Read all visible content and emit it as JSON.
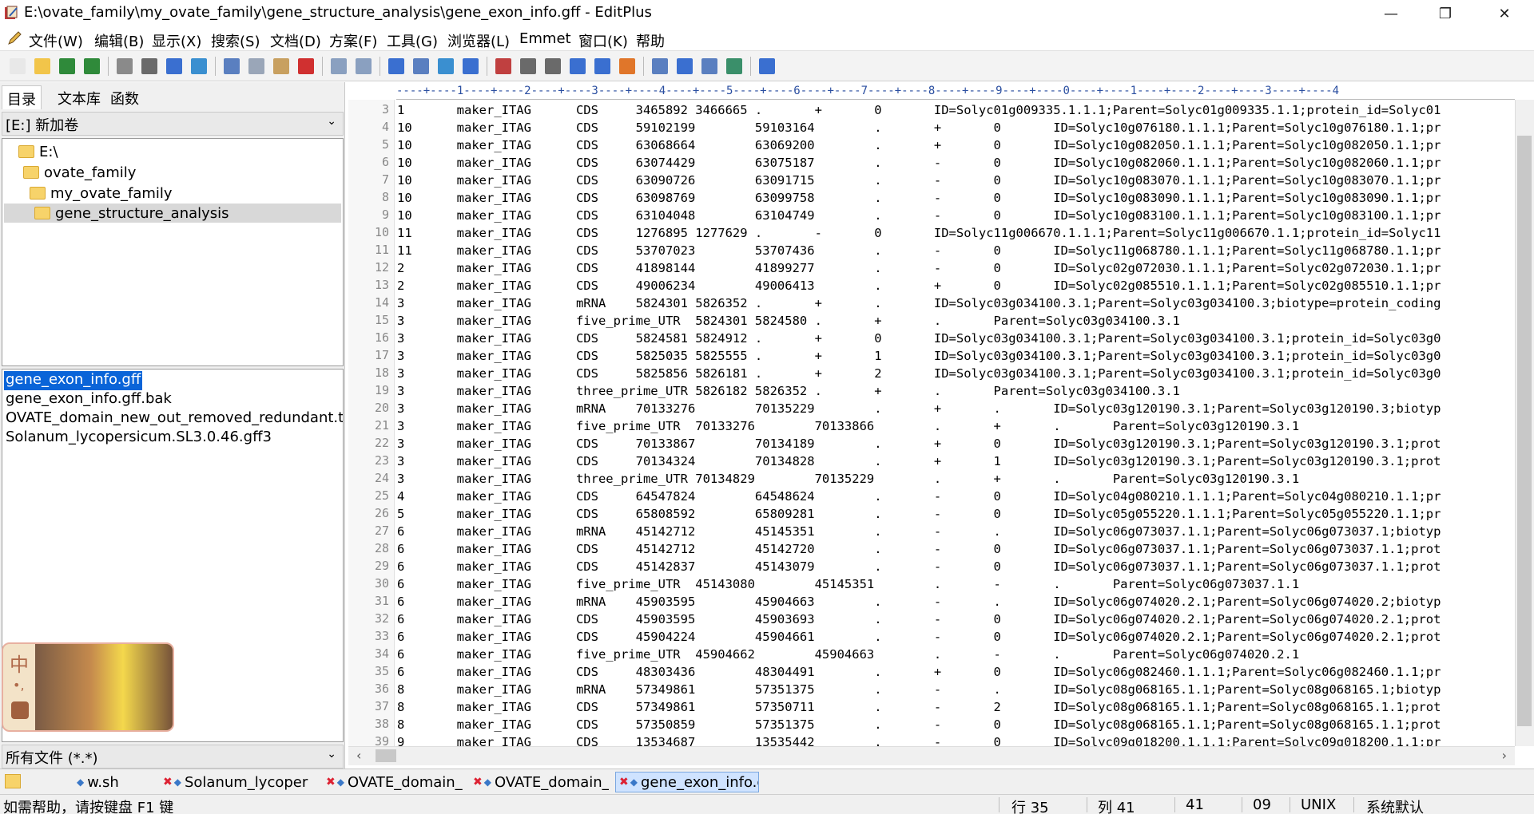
{
  "window": {
    "title": "E:\\ovate_family\\my_ovate_family\\gene_structure_analysis\\gene_exon_info.gff - EditPlus",
    "minimize": "—",
    "restore": "❐",
    "close": "✕"
  },
  "menu": [
    "文件(W)",
    "编辑(B)",
    "显示(X)",
    "搜索(S)",
    "文档(D)",
    "方案(F)",
    "工具(G)",
    "浏览器(L)",
    "Emmet",
    "窗口(K)",
    "帮助"
  ],
  "mdi": {
    "minimize": "–",
    "restore": "▫",
    "close": "×"
  },
  "toolbar_icons": [
    {
      "name": "new-file-icon",
      "color": "#e8e8e8"
    },
    {
      "name": "open-folder-icon",
      "color": "#f2c54a"
    },
    {
      "name": "save-icon",
      "color": "#2f8a3a"
    },
    {
      "name": "save-all-icon",
      "color": "#2f8a3a"
    },
    {
      "name": "print-preview-icon",
      "color": "#8a8a8a"
    },
    {
      "name": "print-icon",
      "color": "#6a6a6a"
    },
    {
      "name": "spell-check-icon",
      "color": "#3a6fd0"
    },
    {
      "name": "browser-view-icon",
      "color": "#3a8fd0"
    },
    {
      "name": "cut-icon",
      "color": "#5a7fc0"
    },
    {
      "name": "copy-icon",
      "color": "#9aa6b8"
    },
    {
      "name": "paste-icon",
      "color": "#c8a060"
    },
    {
      "name": "delete-icon",
      "color": "#d03030"
    },
    {
      "name": "undo-icon",
      "color": "#8aa0c0"
    },
    {
      "name": "redo-icon",
      "color": "#8aa0c0"
    },
    {
      "name": "find-icon",
      "color": "#3a6fd0"
    },
    {
      "name": "replace-icon",
      "color": "#5a7fc0"
    },
    {
      "name": "find-in-files-icon",
      "color": "#3a8fd0"
    },
    {
      "name": "goto-line-icon",
      "color": "#3a6fd0"
    },
    {
      "name": "font-icon",
      "color": "#c04040"
    },
    {
      "name": "hex-icon",
      "color": "#6a6a6a"
    },
    {
      "name": "word-wrap-icon",
      "color": "#6a6a6a"
    },
    {
      "name": "line-number-icon",
      "color": "#3a6fd0"
    },
    {
      "name": "spell-toggle-icon",
      "color": "#3a6fd0"
    },
    {
      "name": "check-icon",
      "color": "#e0762a"
    },
    {
      "name": "directory-window-icon",
      "color": "#5a7fc0"
    },
    {
      "name": "cliptext-window-icon",
      "color": "#3a6fd0"
    },
    {
      "name": "output-window-icon",
      "color": "#5a7fc0"
    },
    {
      "name": "fullscreen-icon",
      "color": "#3a8f6a"
    },
    {
      "name": "help-icon",
      "color": "#3a6fd0"
    }
  ],
  "left_tabs": [
    "目录",
    "文本库",
    "函数"
  ],
  "drive": "[E:] 新加卷",
  "tree": [
    "E:\\",
    "ovate_family",
    "my_ovate_family",
    "gene_structure_analysis"
  ],
  "files": [
    "gene_exon_info.gff",
    "gene_exon_info.gff.bak",
    "OVATE_domain_new_out_removed_redundant.txt",
    "Solanum_lycopersicum.SL3.0.46.gff3"
  ],
  "filter": "所有文件 (*.*)",
  "ime": {
    "label1": "中",
    "label2": "•,"
  },
  "ruler": "----+----1----+----2----+----3----+----4----+----5----+----6----+----7----+----8----+----9----+----0----+----1----+----2----+----3----+----4",
  "lines": [
    {
      "n": "3",
      "t": "1       maker_ITAG      CDS     3465892 3466665 .       +       0       ID=Solyc01g009335.1.1.1;Parent=Solyc01g009335.1.1;protein_id=Solyc01"
    },
    {
      "n": "4",
      "t": "10      maker_ITAG      CDS     59102199        59103164        .       +       0       ID=Solyc10g076180.1.1.1;Parent=Solyc10g076180.1.1;pr"
    },
    {
      "n": "5",
      "t": "10      maker_ITAG      CDS     63068664        63069200        .       +       0       ID=Solyc10g082050.1.1.1;Parent=Solyc10g082050.1.1;pr"
    },
    {
      "n": "6",
      "t": "10      maker_ITAG      CDS     63074429        63075187        .       -       0       ID=Solyc10g082060.1.1.1;Parent=Solyc10g082060.1.1;pr"
    },
    {
      "n": "7",
      "t": "10      maker_ITAG      CDS     63090726        63091715        .       -       0       ID=Solyc10g083070.1.1.1;Parent=Solyc10g083070.1.1;pr"
    },
    {
      "n": "8",
      "t": "10      maker_ITAG      CDS     63098769        63099758        .       -       0       ID=Solyc10g083090.1.1.1;Parent=Solyc10g083090.1.1;pr"
    },
    {
      "n": "9",
      "t": "10      maker_ITAG      CDS     63104048        63104749        .       -       0       ID=Solyc10g083100.1.1.1;Parent=Solyc10g083100.1.1;pr"
    },
    {
      "n": "10",
      "t": "11      maker_ITAG      CDS     1276895 1277629 .       -       0       ID=Solyc11g006670.1.1.1;Parent=Solyc11g006670.1.1;protein_id=Solyc11"
    },
    {
      "n": "11",
      "t": "11      maker_ITAG      CDS     53707023        53707436        .       -       0       ID=Solyc11g068780.1.1.1;Parent=Solyc11g068780.1.1;pr"
    },
    {
      "n": "12",
      "t": "2       maker_ITAG      CDS     41898144        41899277        .       -       0       ID=Solyc02g072030.1.1.1;Parent=Solyc02g072030.1.1;pr"
    },
    {
      "n": "13",
      "t": "2       maker_ITAG      CDS     49006234        49006413        .       +       0       ID=Solyc02g085510.1.1.1;Parent=Solyc02g085510.1.1;pr"
    },
    {
      "n": "14",
      "t": "3       maker_ITAG      mRNA    5824301 5826352 .       +       .       ID=Solyc03g034100.3.1;Parent=Solyc03g034100.3;biotype=protein_coding"
    },
    {
      "n": "15",
      "t": "3       maker_ITAG      five_prime_UTR  5824301 5824580 .       +       .       Parent=Solyc03g034100.3.1"
    },
    {
      "n": "16",
      "t": "3       maker_ITAG      CDS     5824581 5824912 .       +       0       ID=Solyc03g034100.3.1;Parent=Solyc03g034100.3.1;protein_id=Solyc03g0"
    },
    {
      "n": "17",
      "t": "3       maker_ITAG      CDS     5825035 5825555 .       +       1       ID=Solyc03g034100.3.1;Parent=Solyc03g034100.3.1;protein_id=Solyc03g0"
    },
    {
      "n": "18",
      "t": "3       maker_ITAG      CDS     5825856 5826181 .       +       2       ID=Solyc03g034100.3.1;Parent=Solyc03g034100.3.1;protein_id=Solyc03g0"
    },
    {
      "n": "19",
      "t": "3       maker_ITAG      three_prime_UTR 5826182 5826352 .       +       .       Parent=Solyc03g034100.3.1"
    },
    {
      "n": "20",
      "t": "3       maker_ITAG      mRNA    70133276        70135229        .       +       .       ID=Solyc03g120190.3.1;Parent=Solyc03g120190.3;biotyp"
    },
    {
      "n": "21",
      "t": "3       maker_ITAG      five_prime_UTR  70133276        70133866        .       +       .       Parent=Solyc03g120190.3.1"
    },
    {
      "n": "22",
      "t": "3       maker_ITAG      CDS     70133867        70134189        .       +       0       ID=Solyc03g120190.3.1;Parent=Solyc03g120190.3.1;prot"
    },
    {
      "n": "23",
      "t": "3       maker_ITAG      CDS     70134324        70134828        .       +       1       ID=Solyc03g120190.3.1;Parent=Solyc03g120190.3.1;prot"
    },
    {
      "n": "24",
      "t": "3       maker_ITAG      three_prime_UTR 70134829        70135229        .       +       .       Parent=Solyc03g120190.3.1"
    },
    {
      "n": "25",
      "t": "4       maker_ITAG      CDS     64547824        64548624        .       -       0       ID=Solyc04g080210.1.1.1;Parent=Solyc04g080210.1.1;pr"
    },
    {
      "n": "26",
      "t": "5       maker_ITAG      CDS     65808592        65809281        .       -       0       ID=Solyc05g055220.1.1.1;Parent=Solyc05g055220.1.1;pr"
    },
    {
      "n": "27",
      "t": "6       maker_ITAG      mRNA    45142712        45145351        .       -       .       ID=Solyc06g073037.1.1;Parent=Solyc06g073037.1;biotyp"
    },
    {
      "n": "28",
      "t": "6       maker_ITAG      CDS     45142712        45142720        .       -       0       ID=Solyc06g073037.1.1;Parent=Solyc06g073037.1.1;prot"
    },
    {
      "n": "29",
      "t": "6       maker_ITAG      CDS     45142837        45143079        .       -       0       ID=Solyc06g073037.1.1;Parent=Solyc06g073037.1.1;prot"
    },
    {
      "n": "30",
      "t": "6       maker_ITAG      five_prime_UTR  45143080        45145351        .       -       .       Parent=Solyc06g073037.1.1"
    },
    {
      "n": "31",
      "t": "6       maker_ITAG      mRNA    45903595        45904663        .       -       .       ID=Solyc06g074020.2.1;Parent=Solyc06g074020.2;biotyp"
    },
    {
      "n": "32",
      "t": "6       maker_ITAG      CDS     45903595        45903693        .       -       0       ID=Solyc06g074020.2.1;Parent=Solyc06g074020.2.1;prot"
    },
    {
      "n": "33",
      "t": "6       maker_ITAG      CDS     45904224        45904661        .       -       0       ID=Solyc06g074020.2.1;Parent=Solyc06g074020.2.1;prot"
    },
    {
      "n": "34",
      "t": "6       maker_ITAG      five_prime_UTR  45904662        45904663        .       -       .       Parent=Solyc06g074020.2.1"
    },
    {
      "n": "35",
      "t": "6       maker_ITAG      CDS     48303436        48304491        .       +       0       ID=Solyc06g082460.1.1.1;Parent=Solyc06g082460.1.1;pr"
    },
    {
      "n": "36",
      "t": "8       maker_ITAG      mRNA    57349861        57351375        .       -       .       ID=Solyc08g068165.1.1;Parent=Solyc08g068165.1;biotyp"
    },
    {
      "n": "37",
      "t": "8       maker_ITAG      CDS     57349861        57350711        .       -       2       ID=Solyc08g068165.1.1;Parent=Solyc08g068165.1.1;prot"
    },
    {
      "n": "38",
      "t": "8       maker_ITAG      CDS     57350859        57351375        .       -       0       ID=Solyc08g068165.1.1;Parent=Solyc08g068165.1.1;prot"
    },
    {
      "n": "39",
      "t": "9       maker_ITAG      CDS     13534687        13535442        .       -       0       ID=Solyc09g018200.1.1.1;Parent=Solyc09g018200.1.1;pr"
    }
  ],
  "doc_tabs": [
    {
      "label": "w.sh",
      "active": false
    },
    {
      "label": "Solanum_lycoper",
      "active": false
    },
    {
      "label": "OVATE_domain_r",
      "active": false
    },
    {
      "label": "OVATE_domain_r",
      "active": false
    },
    {
      "label": "gene_exon_info.g",
      "active": true
    }
  ],
  "status": {
    "help": "如需帮助，请按键盘 F1 键",
    "row": "行 35",
    "col": "列 41",
    "num1": "41",
    "num2": "09",
    "eol": "UNIX",
    "encoding": "系统默认"
  }
}
